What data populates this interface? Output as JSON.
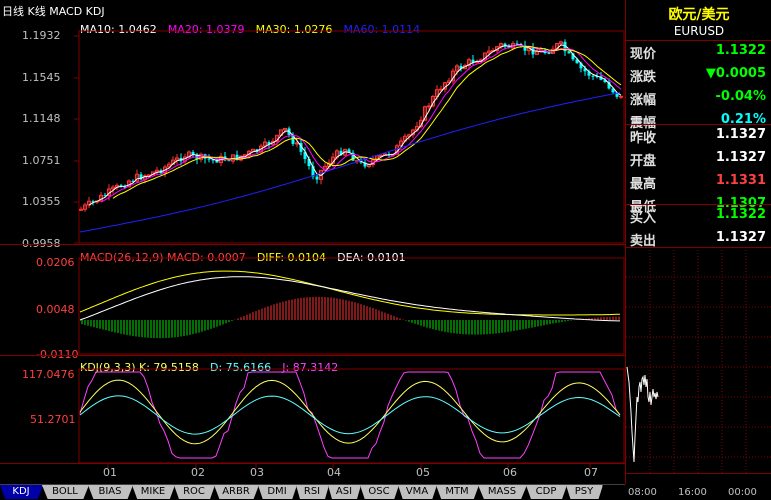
{
  "header": {
    "title": "日线 K线 MACD KDJ",
    "ma": [
      {
        "label": "MA10: 1.0462",
        "color": "#ffffff"
      },
      {
        "label": "MA20: 1.0379",
        "color": "#ff00ff"
      },
      {
        "label": "MA30: 1.0276",
        "color": "#ffff00"
      },
      {
        "label": "MA60: 1.0114",
        "color": "#0000ff"
      }
    ]
  },
  "main_chart": {
    "y_ticks": [
      "1.1932",
      "1.1545",
      "1.1148",
      "1.0751",
      "1.0355",
      "0.9958"
    ],
    "x_ticks": [
      "01",
      "02",
      "03",
      "04",
      "05",
      "06",
      "07"
    ]
  },
  "macd": {
    "legend": "MACD(26,12,9) MACD: 0.0007  DIFF: 0.0104  DEA: 0.0101",
    "legend_parts": [
      {
        "text": "MACD(26,12,9) MACD: 0.0007",
        "color": "#ff4040"
      },
      {
        "text": "DIFF: 0.0104",
        "color": "#ffff00"
      },
      {
        "text": "DEA: 0.0101",
        "color": "#ffffff"
      }
    ],
    "y_ticks": [
      "0.0206",
      "0.0048",
      "-0.0110"
    ]
  },
  "kdj": {
    "legend_parts": [
      {
        "text": "KDJ(9,3,3) K: 79.5158",
        "color": "#ffff60"
      },
      {
        "text": "D: 75.6166",
        "color": "#60ffff"
      },
      {
        "text": "J: 87.3142",
        "color": "#ff40ff"
      }
    ],
    "y_ticks": [
      "117.0476",
      "51.2701"
    ]
  },
  "quote": {
    "name": "欧元/美元",
    "code": "EURUSD",
    "rows": [
      {
        "k": "现价",
        "v": "1.1322",
        "color": "#00ff00"
      },
      {
        "k": "涨跌",
        "v": "▼0.0005",
        "color": "#00ff00"
      },
      {
        "k": "涨幅",
        "v": "-0.04%",
        "color": "#00ff00"
      },
      {
        "k": "震幅",
        "v": "0.21%",
        "color": "#00ffff"
      },
      {
        "k": "昨收",
        "v": "1.1327",
        "color": "#ffffff"
      },
      {
        "k": "开盘",
        "v": "1.1327",
        "color": "#ffffff"
      },
      {
        "k": "最高",
        "v": "1.1331",
        "color": "#ff4040"
      },
      {
        "k": "最低",
        "v": "1.1307",
        "color": "#00ff00"
      },
      {
        "k": "买入",
        "v": "1.1322",
        "color": "#00ff00"
      },
      {
        "k": "卖出",
        "v": "1.1327",
        "color": "#ffffff"
      }
    ],
    "time_ticks": [
      "08:00",
      "16:00",
      "00:00"
    ]
  },
  "tabs": [
    "KDJ",
    "BOLL",
    "BIAS",
    "MIKE",
    "ROC",
    "ARBR",
    "DMI",
    "RSI",
    "ASI",
    "OSC",
    "VMA",
    "MTM",
    "MASS",
    "CDP",
    "PSY"
  ],
  "colors": {
    "up": "#ff3232",
    "down": "#00ffff",
    "frame": "#800000",
    "axis_text": "#ff4040"
  }
}
